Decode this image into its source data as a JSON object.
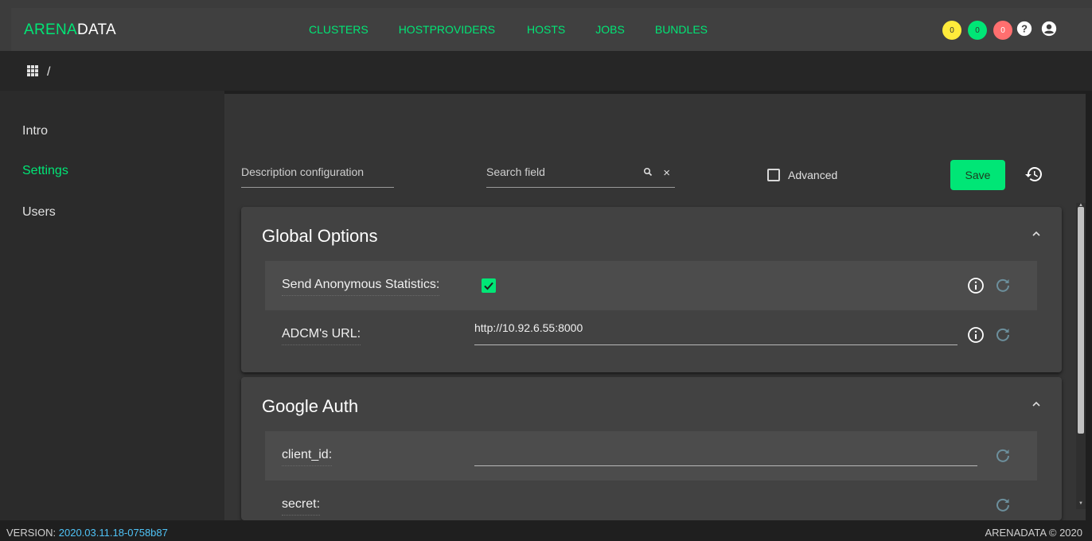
{
  "header": {
    "logo_part1": "ARENA",
    "logo_part2": "DATA",
    "nav": [
      "CLUSTERS",
      "HOSTPROVIDERS",
      "HOSTS",
      "JOBS",
      "BUNDLES"
    ],
    "badges": [
      {
        "count": "0",
        "color": "#ffeb3b"
      },
      {
        "count": "0",
        "color": "#00e676"
      },
      {
        "count": "0",
        "color": "#ff6f6f"
      }
    ]
  },
  "breadcrumb": {
    "separator": "/"
  },
  "sidebar": {
    "items": [
      {
        "label": "Intro",
        "active": false
      },
      {
        "label": "Settings",
        "active": true
      },
      {
        "label": "Users",
        "active": false
      }
    ]
  },
  "toolbar": {
    "description_placeholder": "Description configuration",
    "search_placeholder": "Search field",
    "advanced_label": "Advanced",
    "advanced_checked": false,
    "save_label": "Save"
  },
  "panels": [
    {
      "title": "Global Options",
      "rows": [
        {
          "label": "Send Anonymous Statistics:",
          "type": "checkbox",
          "checked": true
        },
        {
          "label": "ADCM's URL:",
          "type": "text",
          "value": "http://10.92.6.55:8000"
        }
      ]
    },
    {
      "title": "Google Auth",
      "rows": [
        {
          "label": "client_id:",
          "type": "text",
          "value": ""
        },
        {
          "label": "secret:",
          "type": "text",
          "value": ""
        }
      ]
    }
  ],
  "footer": {
    "version_label": "VERSION: ",
    "version": "2020.03.11.18-0758b87",
    "copyright": "ARENADATA © 2020"
  },
  "colors": {
    "accent": "#00e676",
    "link": "#4fc3f7"
  }
}
